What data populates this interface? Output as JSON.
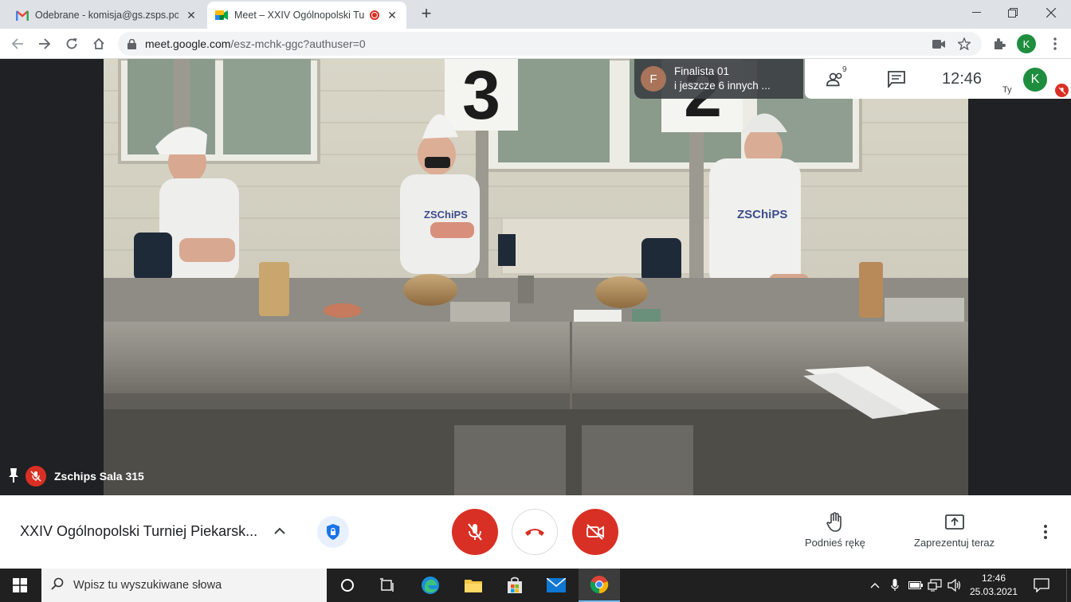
{
  "browser": {
    "tabs": [
      {
        "title": "Odebrane - komisja@gs.zsps.poznan.pl",
        "icon": "gmail-icon",
        "active": false
      },
      {
        "title": "Meet – XXIV Ogólnopolski Turniej Piekarski",
        "icon": "meet-icon",
        "active": true,
        "recording": true
      }
    ],
    "url": {
      "host": "meet.google.com",
      "path": "/esz-mchk-ggc?authuser=0"
    },
    "profile_initial": "K"
  },
  "meet": {
    "participants_pill": {
      "avatar_initial": "F",
      "line1": "Finalista 01",
      "line2": "i jeszcze 6 innych ..."
    },
    "participant_count": "9",
    "clock": "12:46",
    "self": {
      "initial": "K",
      "label": "Ty"
    },
    "tile_name": "Zschips Sala 315",
    "meeting_title": "XXIV Ogólnopolski Turniej Piekarsk...",
    "actions": {
      "raise_hand": "Podnieś rękę",
      "present": "Zaprezentuj teraz"
    },
    "video_content": {
      "station_numbers": [
        "3",
        "2"
      ],
      "shirt_text": "ZSChiPS"
    }
  },
  "taskbar": {
    "search_placeholder": "Wpisz tu wyszukiwane słowa",
    "time": "12:46",
    "date": "25.03.2021"
  },
  "colors": {
    "meet_red": "#d93025",
    "meet_green": "#1e8e3e",
    "chrome_tabbar": "#dee1e6",
    "taskbar": "#202020"
  }
}
